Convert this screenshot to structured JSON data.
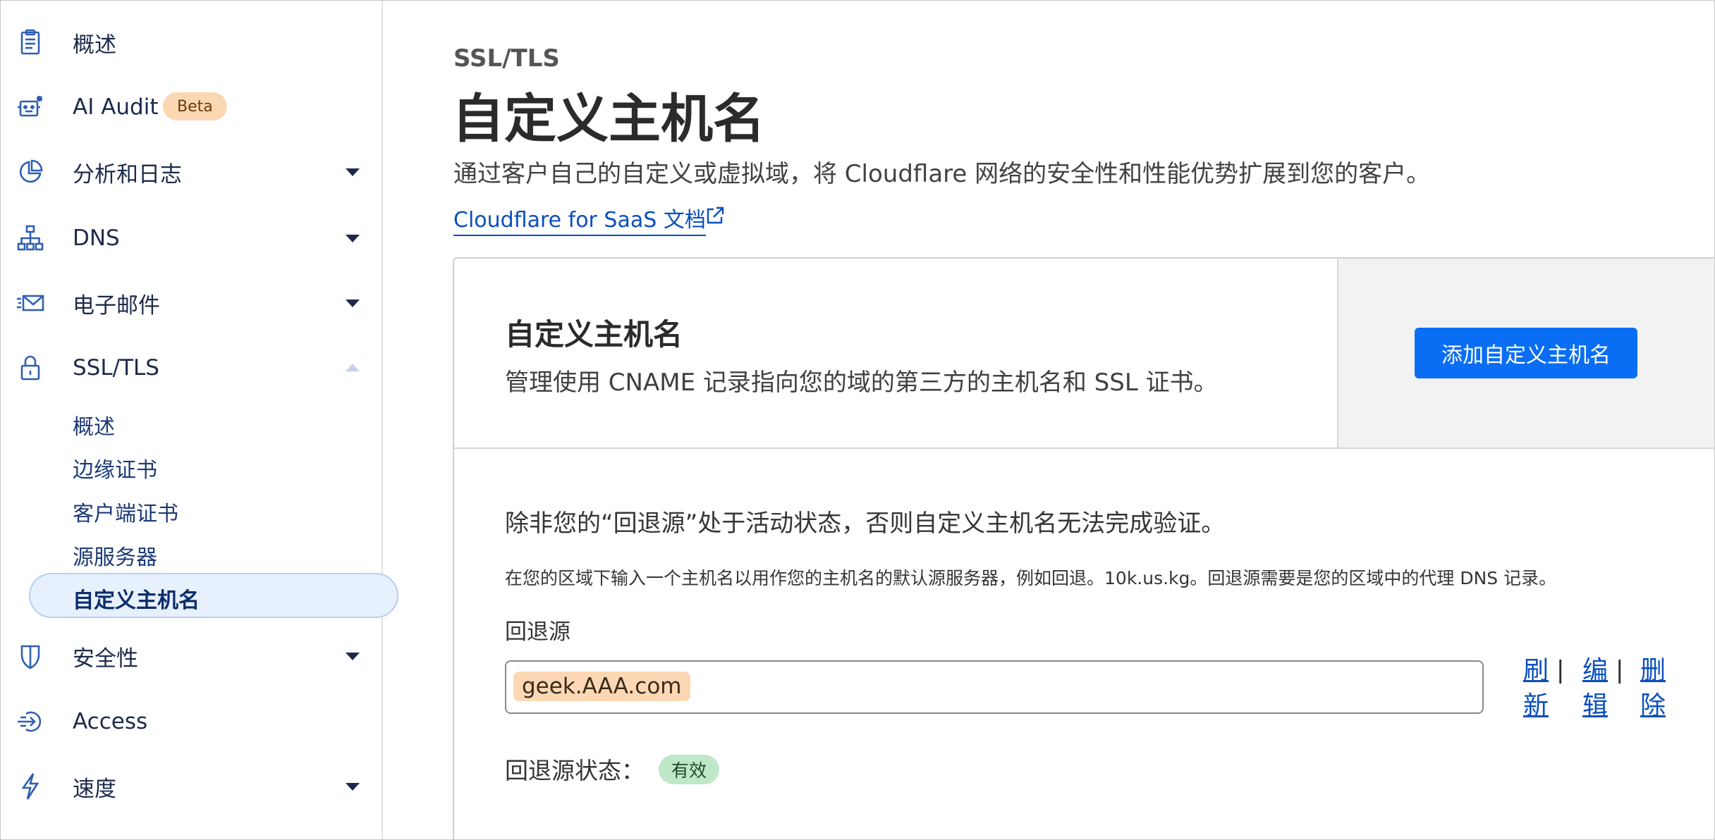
{
  "sidebar": {
    "items": [
      {
        "label": "概述",
        "icon": "clipboard-icon"
      },
      {
        "label": "AI Audit",
        "icon": "robot-icon",
        "badge": "Beta"
      },
      {
        "label": "分析和日志",
        "icon": "pie-chart-icon",
        "expandable": true
      },
      {
        "label": "DNS",
        "icon": "sitemap-icon",
        "expandable": true
      },
      {
        "label": "电子邮件",
        "icon": "email-icon",
        "expandable": true
      },
      {
        "label": "SSL/TLS",
        "icon": "lock-icon",
        "expanded": true
      },
      {
        "label": "安全性",
        "icon": "shield-icon",
        "expandable": true
      },
      {
        "label": "Access",
        "icon": "access-icon"
      },
      {
        "label": "速度",
        "icon": "lightning-icon",
        "expandable": true
      }
    ],
    "ssl_subitems": [
      "概述",
      "边缘证书",
      "客户端证书",
      "源服务器",
      "自定义主机名"
    ],
    "active_subitem": "自定义主机名"
  },
  "main": {
    "breadcrumb": "SSL/TLS",
    "title": "自定义主机名",
    "description": "通过客户自己的自定义或虚拟域，将 Cloudflare 网络的安全性和性能优势扩展到您的客户。",
    "doc_link": "Cloudflare for SaaS 文档",
    "card": {
      "title": "自定义主机名",
      "description": "管理使用 CNAME 记录指向您的域的第三方的主机名和 SSL 证书。",
      "add_button": "添加自定义主机名",
      "warning": "除非您的“回退源”处于活动状态，否则自定义主机名无法完成验证。",
      "hint": "在您的区域下输入一个主机名以用作您的主机名的默认源服务器，例如回退。10k.us.kg。回退源需要是您的区域中的代理 DNS 记录。",
      "fallback_label": "回退源",
      "fallback_value": "geek.AAA.com",
      "actions": {
        "refresh": "刷新",
        "edit": "编辑",
        "delete": "删除"
      },
      "status_label": "回退源状态：",
      "status_value": "有效"
    }
  },
  "colors": {
    "accent": "#0a6ef5",
    "link": "#0a4fbd",
    "badge_beta": "#fbd8b3",
    "status_ok": "#bfe8c8"
  }
}
